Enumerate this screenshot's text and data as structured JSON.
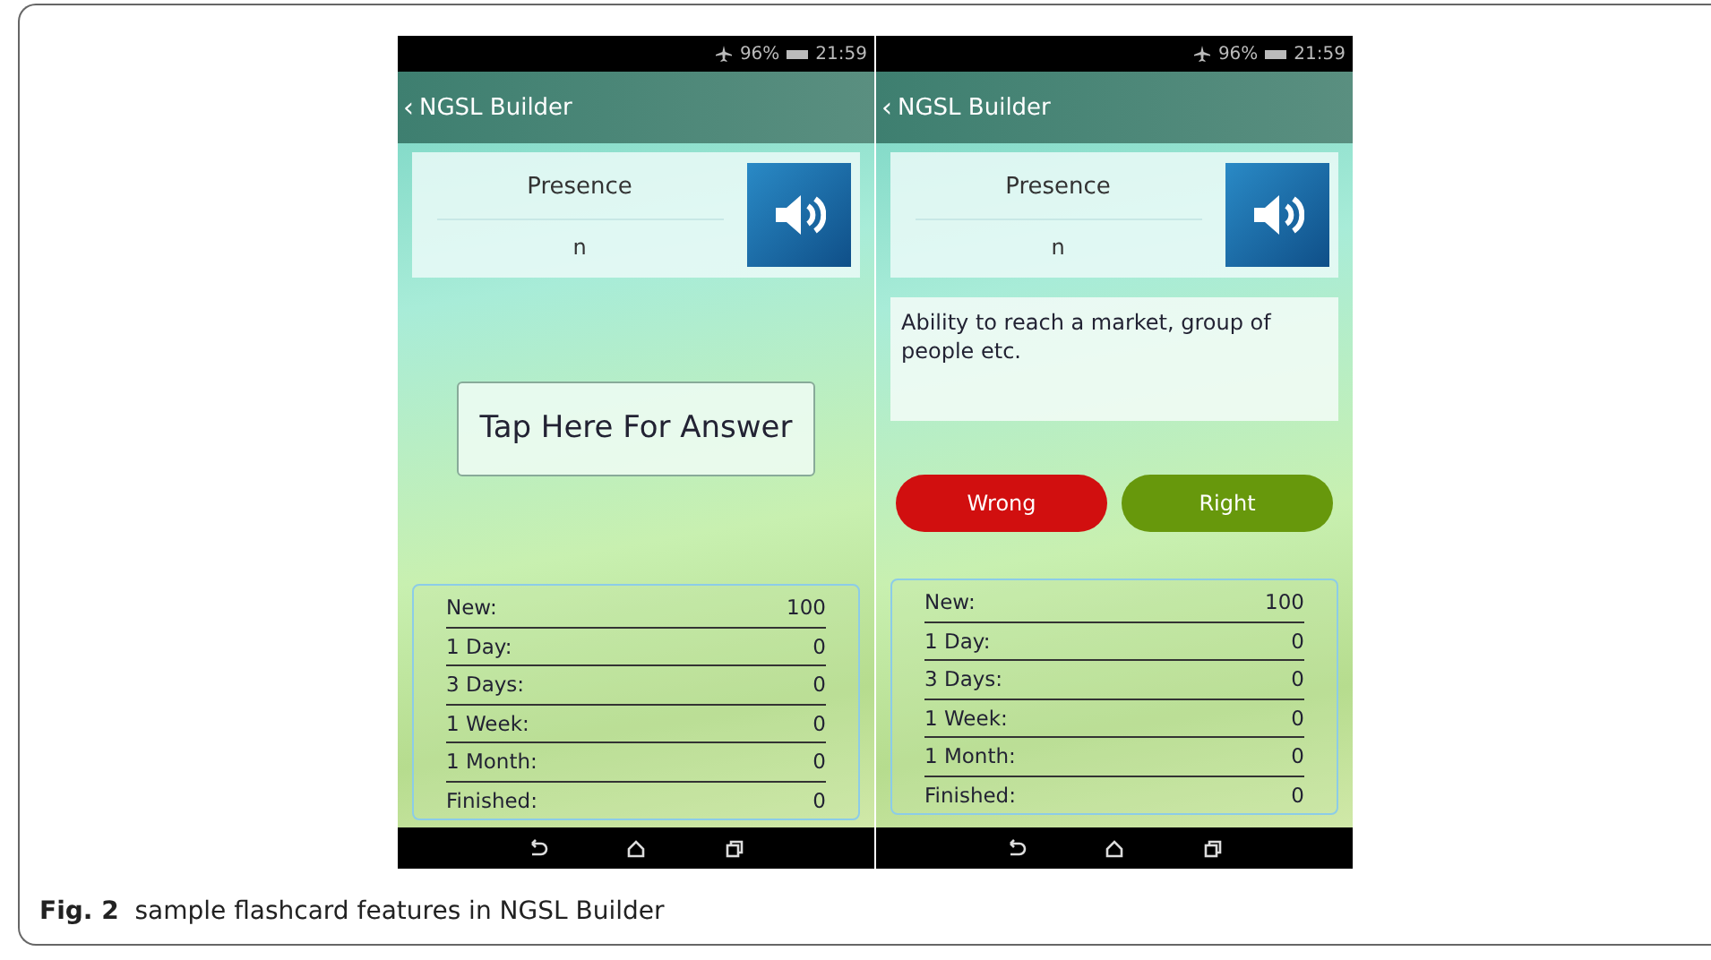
{
  "screens": [
    {
      "kind": "question",
      "status": {
        "battery": "96%",
        "time": "21:59"
      },
      "title": "NGSL Builder",
      "back": "‹",
      "word": "Presence",
      "part_of_speech": "n",
      "answer_button": "Tap Here For Answer",
      "stats": [
        {
          "label": "New:",
          "value": "100"
        },
        {
          "label": "1 Day:",
          "value": "0"
        },
        {
          "label": "3 Days:",
          "value": "0"
        },
        {
          "label": "1 Week:",
          "value": "0"
        },
        {
          "label": "1 Month:",
          "value": "0"
        },
        {
          "label": "Finished:",
          "value": "0"
        }
      ]
    },
    {
      "kind": "answer",
      "status": {
        "battery": "96%",
        "time": "21:59"
      },
      "title": "NGSL Builder",
      "back": "‹",
      "word": "Presence",
      "part_of_speech": "n",
      "definition": "Ability to reach a market, group of people etc.",
      "grade_buttons": [
        {
          "label": "Wrong",
          "color": "#d10f0f"
        },
        {
          "label": "Right",
          "color": "#67980c"
        }
      ],
      "stats": [
        {
          "label": "New:",
          "value": "100"
        },
        {
          "label": "1 Day:",
          "value": "0"
        },
        {
          "label": "3 Days:",
          "value": "0"
        },
        {
          "label": "1 Week:",
          "value": "0"
        },
        {
          "label": "1 Month:",
          "value": "0"
        },
        {
          "label": "Finished:",
          "value": "0"
        }
      ]
    }
  ],
  "caption": {
    "label": "Fig. 2",
    "text": "sample flashcard features in NGSL Builder"
  }
}
